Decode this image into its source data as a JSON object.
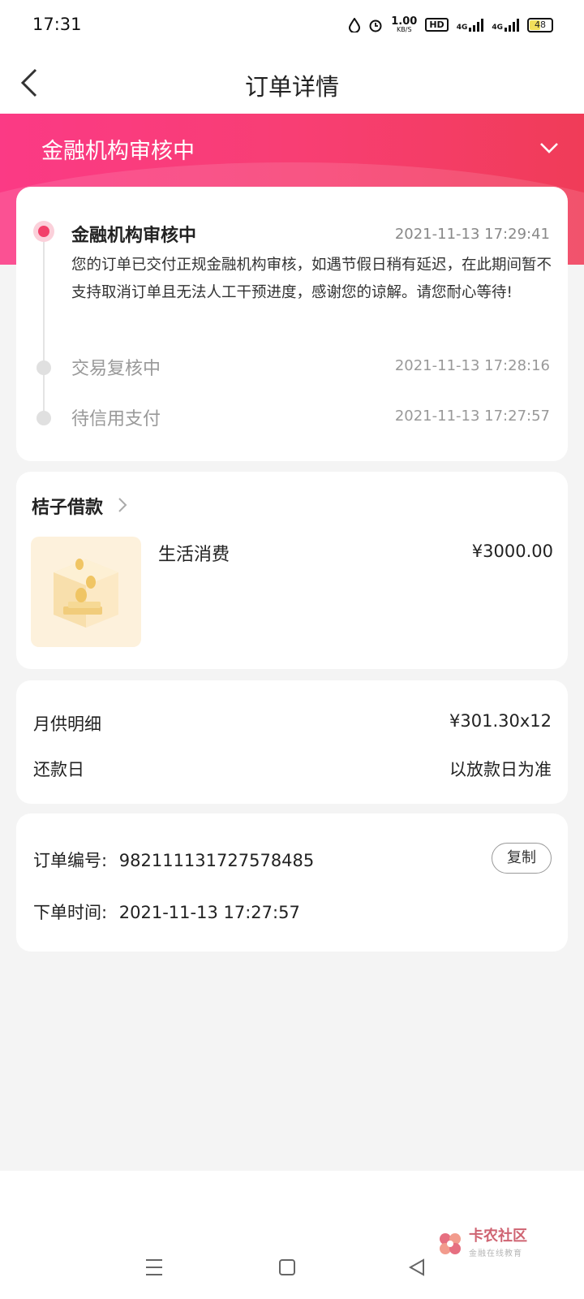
{
  "status_bar": {
    "time": "17:31",
    "speed": "1.00",
    "speed_unit": "KB/S",
    "hd": "HD",
    "net1": "4G",
    "net2": "4G",
    "battery": "48"
  },
  "header": {
    "title": "订单详情",
    "back_icon": "back-chevron-icon"
  },
  "banner": {
    "status_title": "金融机构审核中",
    "toggle_icon": "chevron-down-icon"
  },
  "timeline": {
    "steps": [
      {
        "title": "金融机构审核中",
        "time": "2021-11-13 17:29:41",
        "desc": "您的订单已交付正规金融机构审核，如遇节假日稍有延迟，在此期间暂不支持取消订单且无法人工干预进度，感谢您的谅解。请您耐心等待!",
        "active": true
      },
      {
        "title": "交易复核中",
        "time": "2021-11-13 17:28:16",
        "active": false
      },
      {
        "title": "待信用支付",
        "time": "2021-11-13 17:27:57",
        "active": false
      }
    ]
  },
  "product": {
    "merchant": "桔子借款",
    "category": "生活消费",
    "price": "¥3000.00"
  },
  "repayment": {
    "monthly_label": "月供明细",
    "monthly_value": "¥301.30x12",
    "due_label": "还款日",
    "due_value": "以放款日为准"
  },
  "order": {
    "number_label": "订单编号:",
    "number_value": "982111131727578485",
    "copy_label": "复制",
    "time_label": "下单时间:",
    "time_value": "2021-11-13 17:27:57"
  },
  "watermark": {
    "title": "卡农社区",
    "subtitle": "金融在线教育"
  },
  "colors": {
    "accent": "#f2406a",
    "banner_start": "#fb3a85",
    "banner_end": "#f03c58"
  }
}
